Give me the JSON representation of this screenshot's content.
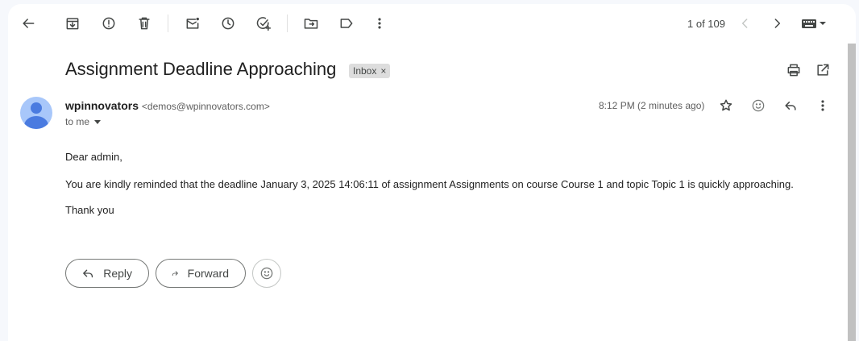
{
  "toolbar": {
    "icons": [
      "back-arrow-icon",
      "archive-icon",
      "report-spam-icon",
      "delete-icon",
      "mark-unread-icon",
      "snooze-icon",
      "add-to-tasks-icon",
      "move-to-icon",
      "label-icon",
      "more-vert-icon"
    ],
    "pagination": "1 of 109",
    "prev_icon": "chevron-left-icon",
    "next_icon": "chevron-right-icon",
    "input_tools_icon": "keyboard-icon"
  },
  "email": {
    "subject": "Assignment Deadline Approaching",
    "label": "Inbox",
    "label_remove": "×",
    "sender_name": "wpinnovators",
    "sender_email": "<demos@wpinnovators.com>",
    "recipient": "to me",
    "time": "8:12 PM (2 minutes ago)",
    "greeting": "Dear admin,",
    "message": "You are kindly reminded that the deadline January 3, 2025 14:06:11 of assignment Assignments on course Course 1 and topic Topic 1 is quickly approaching.",
    "signoff": "Thank you"
  },
  "actions": {
    "reply": "Reply",
    "forward": "Forward"
  },
  "colors": {
    "background": "#f6f8fc",
    "panel": "#ffffff",
    "avatar_bg": "#a8c7fa",
    "avatar_fg": "#4a7be0",
    "label_chip": "#dddddd"
  }
}
